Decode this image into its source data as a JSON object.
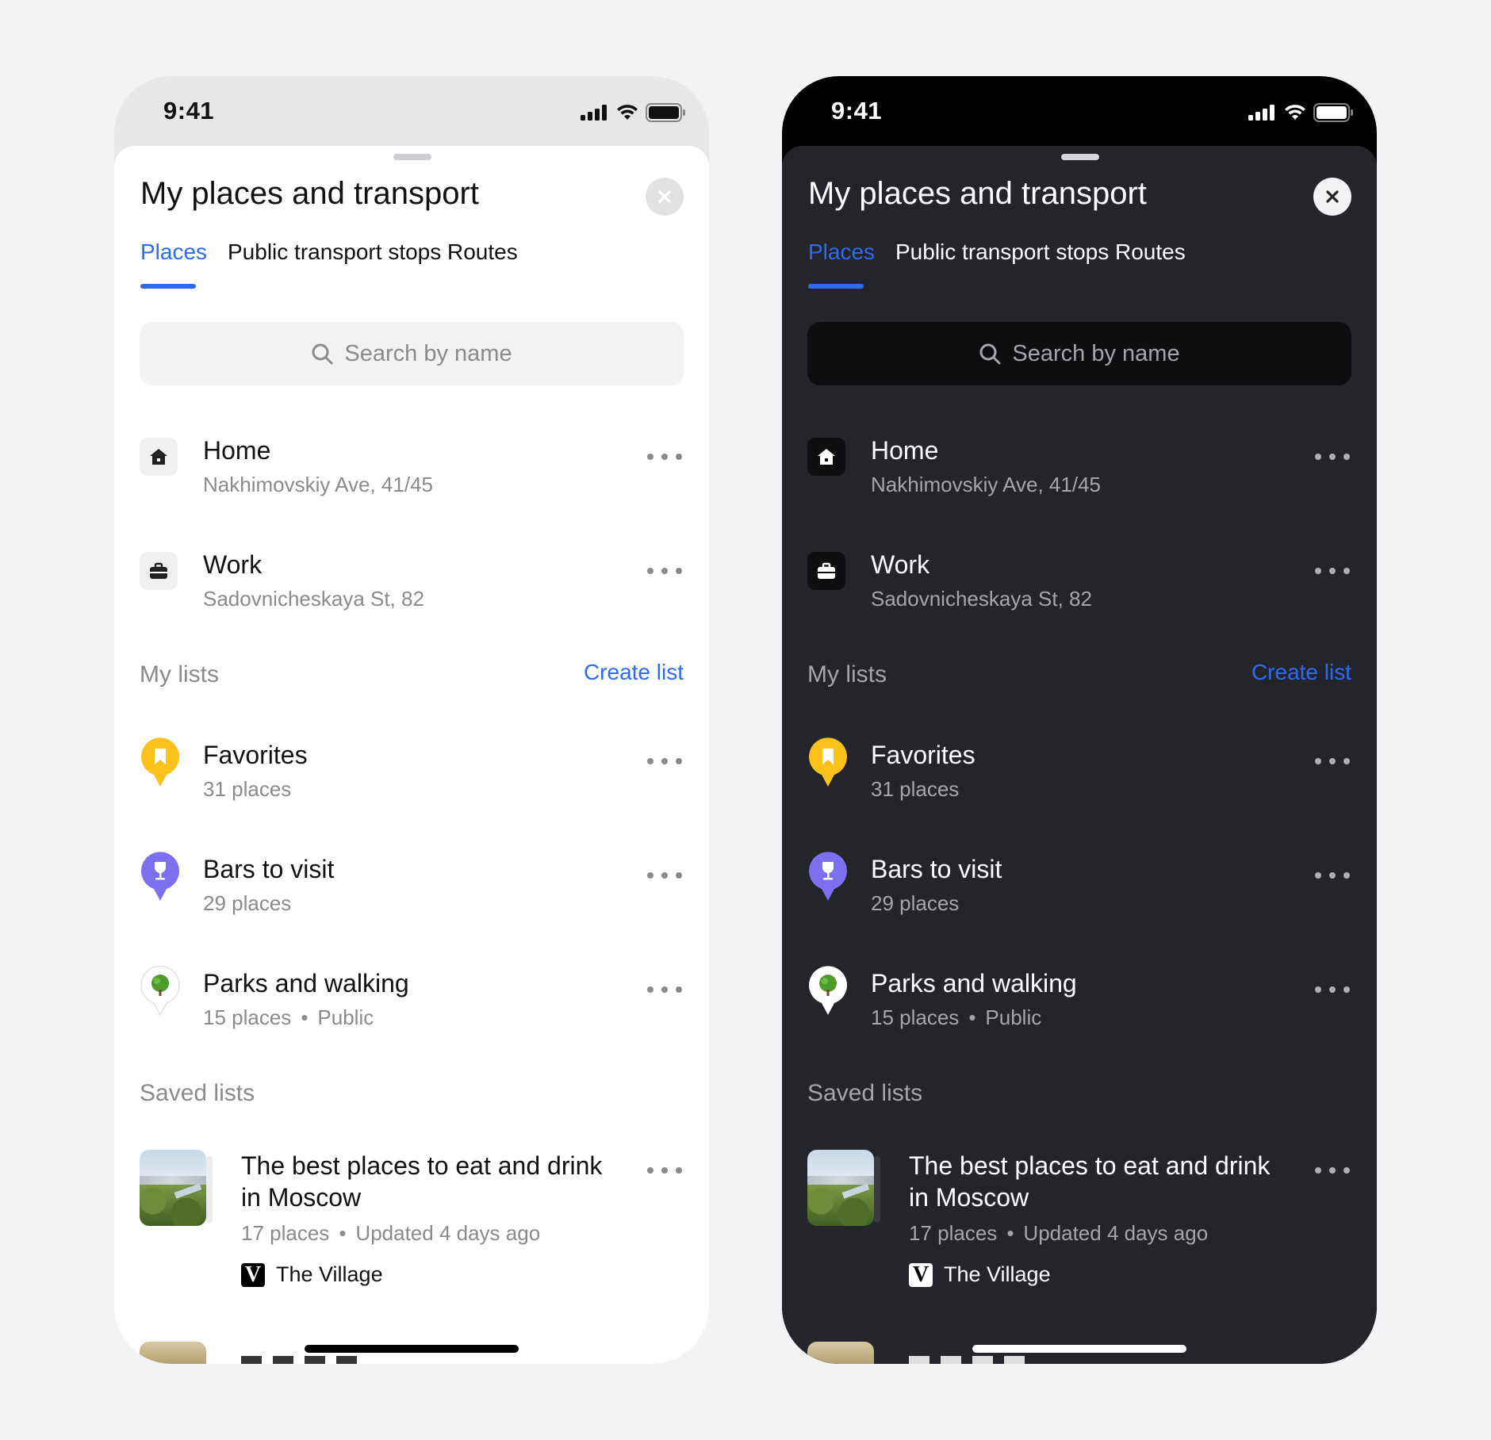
{
  "status": {
    "time": "9:41"
  },
  "sheet": {
    "title": "My places and transport",
    "tabs": [
      {
        "label": "Places",
        "active": true
      },
      {
        "label": "Public transport stops",
        "active": false
      },
      {
        "label": "Routes",
        "active": false
      }
    ],
    "search_placeholder": "Search by name"
  },
  "addresses": [
    {
      "name": "Home",
      "address": "Nakhimovskiy Ave, 41/45",
      "icon": "home-icon"
    },
    {
      "name": "Work",
      "address": "Sadovnicheskaya St, 82",
      "icon": "briefcase-icon"
    }
  ],
  "my_lists": {
    "heading": "My lists",
    "create_label": "Create list",
    "items": [
      {
        "name": "Favorites",
        "meta": "31 places",
        "icon": "bookmark-pin-icon",
        "color": "#fcc21b"
      },
      {
        "name": "Bars to visit",
        "meta": "29 places",
        "icon": "wine-glass-pin-icon",
        "color": "#7c6ff0"
      },
      {
        "name": "Parks and walking",
        "meta": "15 places",
        "visibility": "Public",
        "icon": "tree-pin-icon",
        "color": "#ffffff"
      }
    ]
  },
  "saved_lists": {
    "heading": "Saved lists",
    "items": [
      {
        "title": "The best places to eat and drink in Moscow",
        "places": "17 places",
        "updated": "Updated 4 days ago",
        "brand_letter": "V",
        "brand": "The Village"
      }
    ]
  },
  "colors": {
    "accent": "#2d6af5",
    "light_bg": "#ffffff",
    "dark_bg": "#24252a"
  }
}
